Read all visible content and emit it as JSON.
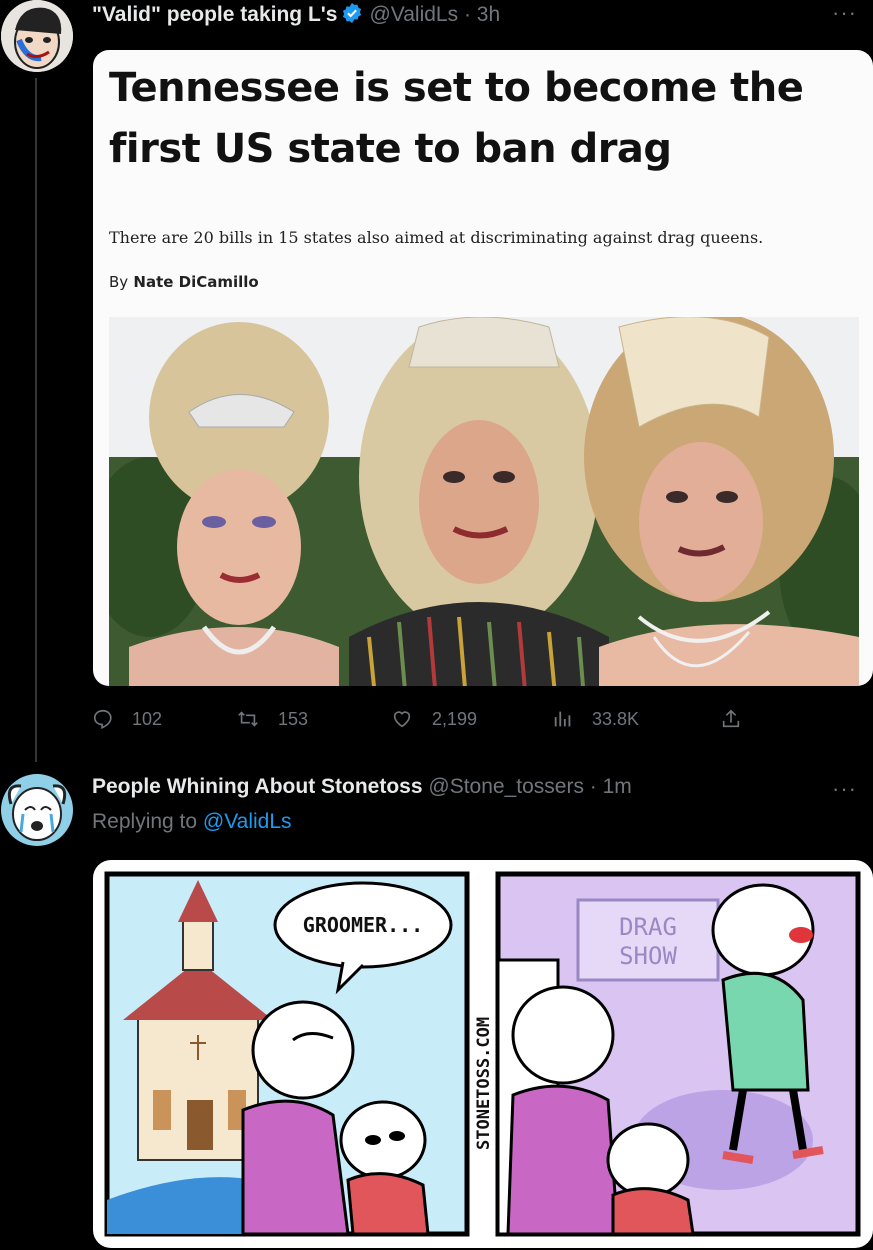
{
  "tweet1": {
    "display_name": "\"Valid\" people taking L's",
    "handle": "@ValidLs",
    "time": "3h",
    "more_icon": "more-dots-icon",
    "article": {
      "headline": "Tennessee is set to become the first US state to ban drag",
      "subhead": "There are 20 bills in 15 states also aimed at discriminating against drag queens.",
      "byline_prefix": "By",
      "byline_author": "Nate DiCamillo"
    },
    "stats": {
      "replies": "102",
      "retweets": "153",
      "likes": "2,199",
      "views": "33.8K"
    }
  },
  "tweet2": {
    "display_name": "People Whining About Stonetoss",
    "handle": "@Stone_tossers",
    "time": "1m",
    "replying_prefix": "Replying to",
    "replying_to": "@ValidLs",
    "comic": {
      "speech_bubble": "GROOMER...",
      "sign_line1": "DRAG",
      "sign_line2": "SHOW",
      "watermark": "STONETOSS.COM"
    }
  },
  "colors": {
    "background": "#000000",
    "text_primary": "#e7e9ea",
    "text_secondary": "#71767b",
    "link": "#1d9bf0",
    "verified": "#1d9bf0"
  }
}
